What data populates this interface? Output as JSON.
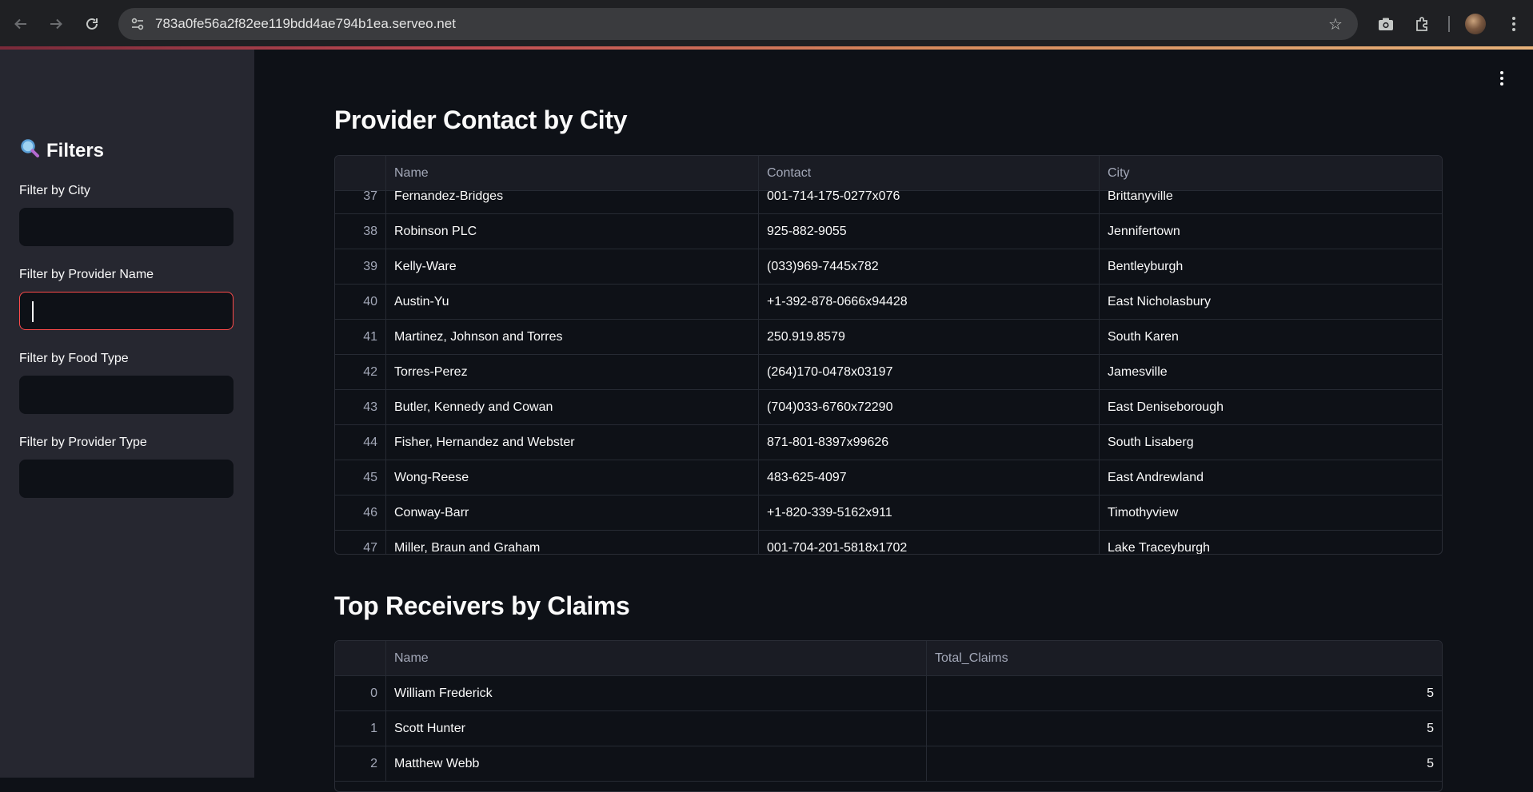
{
  "browser": {
    "url": "783a0fe56a2f82ee119bdd4ae794b1ea.serveo.net",
    "back_icon": "arrow-left-icon",
    "forward_icon": "arrow-right-icon",
    "reload_icon": "reload-icon",
    "accent_color": "#c04a52"
  },
  "sidebar": {
    "title": "Filters",
    "title_icon": "magnifier-icon",
    "filters": [
      {
        "label": "Filter by City",
        "value": "",
        "placeholder": ""
      },
      {
        "label": "Filter by Provider Name",
        "value": "",
        "placeholder": ""
      },
      {
        "label": "Filter by Food Type",
        "value": "",
        "placeholder": ""
      },
      {
        "label": "Filter by Provider Type",
        "value": "",
        "placeholder": ""
      }
    ]
  },
  "provider_section": {
    "title": "Provider Contact by City",
    "columns": [
      "",
      "Name",
      "Contact",
      "City"
    ],
    "rows": [
      {
        "idx": "37",
        "name": "Fernandez-Bridges",
        "contact": "001-714-175-0277x076",
        "city": "Brittanyville"
      },
      {
        "idx": "38",
        "name": "Robinson PLC",
        "contact": "925-882-9055",
        "city": "Jennifertown"
      },
      {
        "idx": "39",
        "name": "Kelly-Ware",
        "contact": "(033)969-7445x782",
        "city": "Bentleyburgh"
      },
      {
        "idx": "40",
        "name": "Austin-Yu",
        "contact": "+1-392-878-0666x94428",
        "city": "East Nicholasbury"
      },
      {
        "idx": "41",
        "name": "Martinez, Johnson and Torres",
        "contact": "250.919.8579",
        "city": "South Karen"
      },
      {
        "idx": "42",
        "name": "Torres-Perez",
        "contact": "(264)170-0478x03197",
        "city": "Jamesville"
      },
      {
        "idx": "43",
        "name": "Butler, Kennedy and Cowan",
        "contact": "(704)033-6760x72290",
        "city": "East Deniseborough"
      },
      {
        "idx": "44",
        "name": "Fisher, Hernandez and Webster",
        "contact": "871-801-8397x99626",
        "city": "South Lisaberg"
      },
      {
        "idx": "45",
        "name": "Wong-Reese",
        "contact": "483-625-4097",
        "city": "East Andrewland"
      },
      {
        "idx": "46",
        "name": "Conway-Barr",
        "contact": "+1-820-339-5162x911",
        "city": "Timothyview"
      },
      {
        "idx": "47",
        "name": "Miller, Braun and Graham",
        "contact": "001-704-201-5818x1702",
        "city": "Lake Traceyburgh"
      }
    ]
  },
  "receivers_section": {
    "title": "Top Receivers by Claims",
    "columns": [
      "",
      "Name",
      "Total_Claims"
    ],
    "rows": [
      {
        "idx": "0",
        "name": "William Frederick",
        "total": "5"
      },
      {
        "idx": "1",
        "name": "Scott Hunter",
        "total": "5"
      },
      {
        "idx": "2",
        "name": "Matthew Webb",
        "total": "5"
      }
    ]
  }
}
